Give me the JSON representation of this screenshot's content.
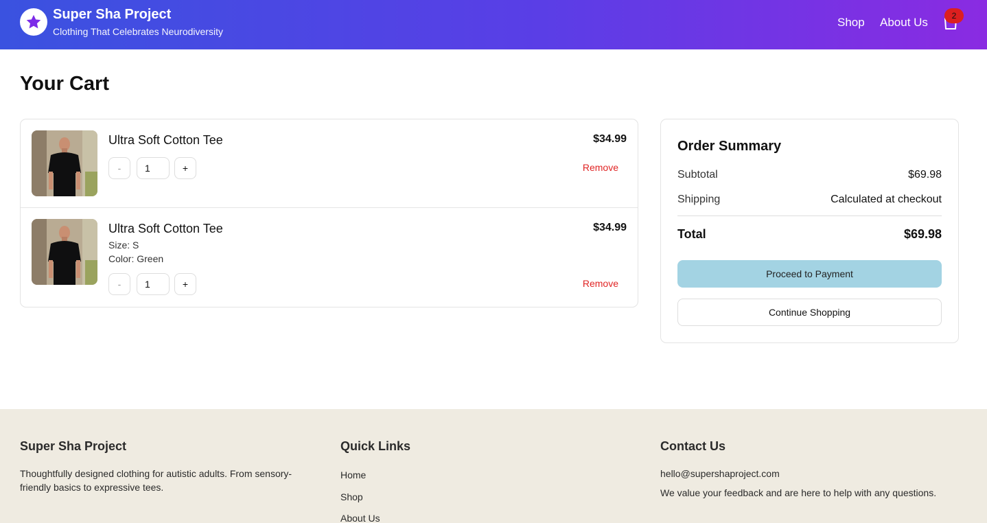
{
  "header": {
    "brand_title": "Super Sha Project",
    "brand_tagline": "Clothing That Celebrates Neurodiversity",
    "nav": {
      "shop": "Shop",
      "about": "About Us"
    },
    "cart_count": "2",
    "logo_icon": "star-icon",
    "cart_icon": "shopping-bag-icon"
  },
  "page": {
    "title": "Your Cart"
  },
  "cart": {
    "items": [
      {
        "name": "Ultra Soft Cotton Tee",
        "price": "$34.99",
        "quantity": "1",
        "minus": "-",
        "plus": "+",
        "remove": "Remove"
      },
      {
        "name": "Ultra Soft Cotton Tee",
        "size": "Size: S",
        "color": "Color: Green",
        "price": "$34.99",
        "quantity": "1",
        "minus": "-",
        "plus": "+",
        "remove": "Remove"
      }
    ]
  },
  "summary": {
    "title": "Order Summary",
    "subtotal_label": "Subtotal",
    "subtotal_value": "$69.98",
    "shipping_label": "Shipping",
    "shipping_value": "Calculated at checkout",
    "total_label": "Total",
    "total_value": "$69.98",
    "pay_button": "Proceed to Payment",
    "continue_button": "Continue Shopping"
  },
  "footer": {
    "brand": {
      "heading": "Super Sha Project",
      "text": "Thoughtfully designed clothing for autistic adults. From sensory-friendly basics to expressive tees."
    },
    "links": {
      "heading": "Quick Links",
      "items": [
        "Home",
        "Shop",
        "About Us"
      ]
    },
    "contact": {
      "heading": "Contact Us",
      "email": "hello@supershaproject.com",
      "note": "We value your feedback and are here to help with any questions."
    }
  },
  "colors": {
    "header_gradient_start": "#3a52e0",
    "header_gradient_end": "#8a2be2",
    "remove": "#e02424",
    "badge": "#dc1f1f",
    "pay_button": "#a3d3e3",
    "footer_bg": "#efebe1"
  }
}
